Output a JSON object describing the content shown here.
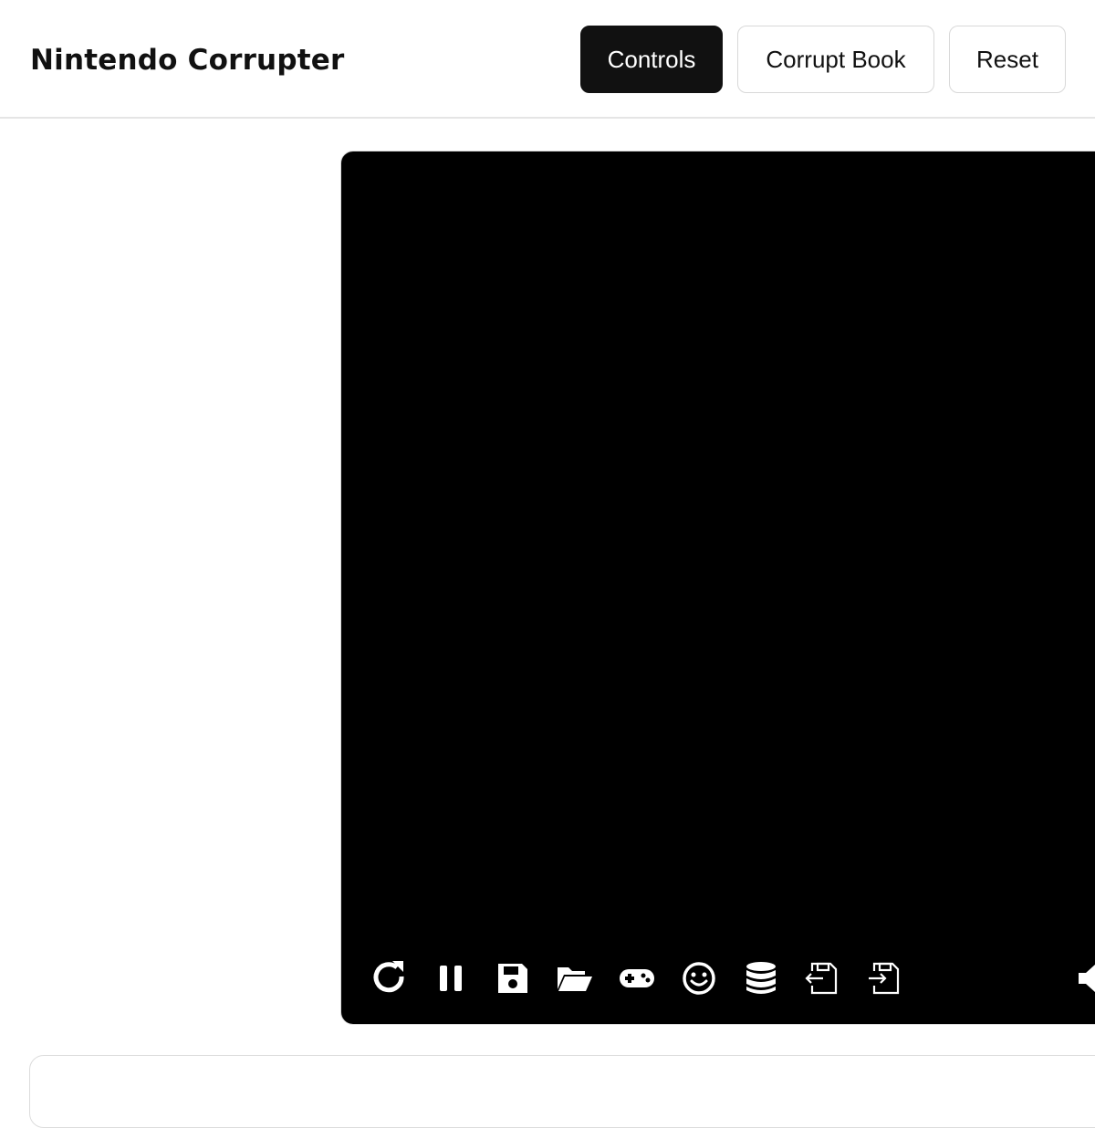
{
  "header": {
    "title": "Nintendo Corrupter",
    "buttons": {
      "controls": "Controls",
      "corrupt_book": "Corrupt Book",
      "reset": "Reset"
    }
  },
  "player": {
    "background": "#000000",
    "toolbar": [
      {
        "icon": "restart-icon"
      },
      {
        "icon": "pause-icon"
      },
      {
        "icon": "save-state-icon"
      },
      {
        "icon": "load-state-icon"
      },
      {
        "icon": "gamepad-icon"
      },
      {
        "icon": "cheats-icon"
      },
      {
        "icon": "cache-icon"
      },
      {
        "icon": "export-save-icon"
      },
      {
        "icon": "import-save-icon"
      },
      {
        "icon": "volume-icon"
      }
    ]
  },
  "colors": {
    "primary_button": "#111111",
    "border": "#d8d8d8"
  }
}
